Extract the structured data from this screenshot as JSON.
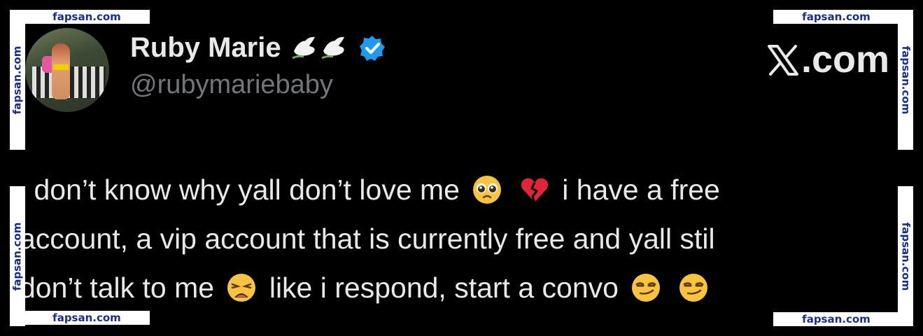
{
  "watermark": {
    "text": "fapsan.com"
  },
  "profile": {
    "display_name": "Ruby Marie",
    "handle": "@rubymariebaby",
    "name_emojis": "dove-icons",
    "verified": true,
    "accent_color": "#1d9bf0"
  },
  "brand": {
    "label": ".com",
    "logo": "x-logo"
  },
  "tweet": {
    "line1_a": "i don’t know why yall don’t love me",
    "line1_b": "i have a free",
    "line2": "account, a vip account that is currently free and yall stil",
    "line3_a": "don’t talk to me",
    "line3_b": "like i respond, start a convo",
    "emojis": [
      "pleading-face-icon",
      "broken-heart-icon",
      "weary-face-icon",
      "smirk-face-icon",
      "smirk-face-icon"
    ]
  },
  "colors": {
    "background": "#000000",
    "text_primary": "#e7e9ea",
    "text_secondary": "#71767b",
    "watermark_text": "#1a2f8a",
    "watermark_bg": "#ffffff"
  }
}
